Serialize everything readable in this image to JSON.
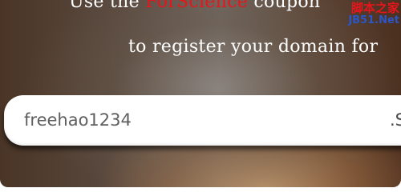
{
  "headline": {
    "prefix": "Use the",
    "coupon_code": "ForScience",
    "suffix": "coupon"
  },
  "subtitle": "to register your domain for",
  "domain_input": {
    "value": "freehao1234",
    "suffix_partial": ".S"
  },
  "watermark": {
    "line1": "脚本之家",
    "line2": "JB51.Net"
  },
  "colors": {
    "coupon_code": "#e8151b",
    "headline_text": "#ffffff",
    "input_text": "#5f5f5f",
    "watermark_red": "#e8151b",
    "watermark_blue": "#2a56c6"
  }
}
